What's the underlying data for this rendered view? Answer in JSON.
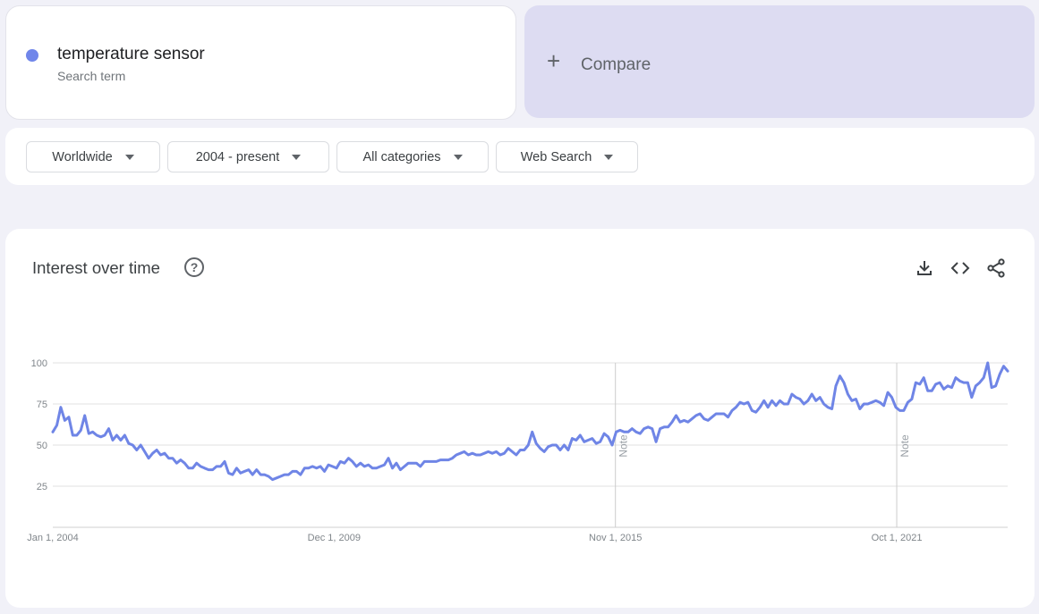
{
  "search": {
    "term": "temperature sensor",
    "term_type": "Search term",
    "term_color": "#7086ea",
    "compare_label": "Compare"
  },
  "filters": {
    "region": "Worldwide",
    "time_range": "2004 - present",
    "category": "All categories",
    "search_type": "Web Search"
  },
  "panel": {
    "title": "Interest over time",
    "icons": [
      "help-icon",
      "download-icon",
      "embed-icon",
      "share-icon"
    ]
  },
  "colors": {
    "line": "#6f85e6",
    "compare_bg": "#dddcf2",
    "page_bg": "#f1f1f8"
  },
  "chart_data": {
    "type": "line",
    "title": "Interest over time",
    "xlabel": "",
    "ylabel": "",
    "ylim": [
      0,
      100
    ],
    "yticks": [
      25,
      50,
      75,
      100
    ],
    "xtick_labels": [
      "Jan 1, 2004",
      "Dec 1, 2009",
      "Nov 1, 2015",
      "Oct 1, 2021"
    ],
    "x_start": "2004-01",
    "x_end": "2024-02",
    "grid": true,
    "annotations": [
      {
        "text": "Note",
        "x": "2015-11"
      },
      {
        "text": "Note",
        "x": "2021-10"
      }
    ],
    "series": [
      {
        "name": "temperature sensor",
        "values": [
          58,
          62,
          73,
          65,
          67,
          56,
          56,
          59,
          68,
          57,
          58,
          56,
          55,
          56,
          60,
          53,
          56,
          53,
          56,
          51,
          50,
          47,
          50,
          46,
          42,
          45,
          47,
          44,
          45,
          42,
          42,
          39,
          41,
          39,
          36,
          36,
          39,
          37,
          36,
          35,
          35,
          37,
          37,
          40,
          33,
          32,
          36,
          33,
          34,
          35,
          32,
          35,
          32,
          32,
          31,
          29,
          30,
          31,
          32,
          32,
          34,
          34,
          32,
          36,
          36,
          37,
          36,
          37,
          34,
          38,
          37,
          36,
          40,
          39,
          42,
          40,
          37,
          39,
          37,
          38,
          36,
          36,
          37,
          38,
          42,
          36,
          39,
          35,
          37,
          39,
          39,
          39,
          37,
          40,
          40,
          40,
          40,
          41,
          41,
          41,
          42,
          44,
          45,
          46,
          44,
          45,
          44,
          44,
          45,
          46,
          45,
          46,
          44,
          45,
          48,
          46,
          44,
          47,
          47,
          50,
          58,
          51,
          48,
          46,
          49,
          50,
          50,
          47,
          50,
          47,
          54,
          53,
          56,
          52,
          53,
          54,
          51,
          52,
          57,
          55,
          50,
          58,
          59,
          58,
          58,
          60,
          58,
          57,
          60,
          61,
          60,
          52,
          60,
          61,
          61,
          64,
          68,
          64,
          65,
          64,
          66,
          68,
          69,
          66,
          65,
          67,
          69,
          69,
          69,
          67,
          71,
          73,
          76,
          75,
          76,
          71,
          70,
          73,
          77,
          73,
          77,
          74,
          77,
          75,
          75,
          81,
          79,
          78,
          75,
          77,
          81,
          77,
          79,
          75,
          73,
          72,
          86,
          92,
          88,
          81,
          77,
          78,
          72,
          75,
          75,
          76,
          77,
          76,
          74,
          82,
          79,
          73,
          71,
          71,
          76,
          78,
          88,
          87,
          91,
          83,
          83,
          87,
          88,
          84,
          86,
          85,
          91,
          89,
          88,
          88,
          79,
          86,
          88,
          91,
          100,
          85,
          86,
          93,
          98,
          95
        ]
      }
    ]
  }
}
